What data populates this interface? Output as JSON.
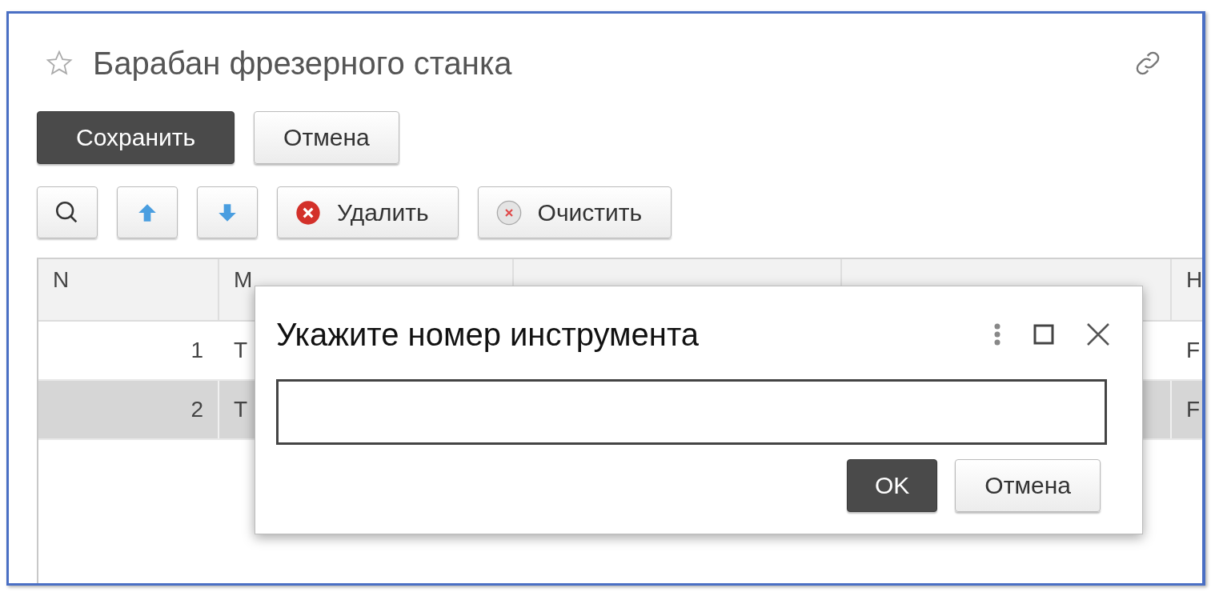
{
  "form": {
    "title": "Барабан фрезерного станка",
    "favorite": false
  },
  "commands": [
    {
      "label": "Сохранить",
      "kind": "primary"
    },
    {
      "label": "Отмена",
      "kind": "plain"
    }
  ],
  "toolbar": [
    {
      "kind": "search"
    },
    {
      "kind": "up"
    },
    {
      "kind": "down"
    },
    {
      "kind": "delete",
      "label": "Удалить"
    },
    {
      "kind": "clear",
      "label": "Очистить"
    }
  ],
  "table": {
    "header": {
      "n": "N",
      "column_2": "М",
      "column_5": "Н"
    },
    "rows": [
      {
        "n": "1",
        "column_2": "Т",
        "column_5": "F",
        "selected": false
      },
      {
        "n": "2",
        "column_2": "Т",
        "column_5": "F",
        "selected": true
      }
    ]
  },
  "dialog": {
    "title": "Укажите номер инструмента",
    "buttons": [
      {
        "label": "OK",
        "kind": "primary"
      },
      {
        "label": "Отмена",
        "kind": "plain"
      }
    ]
  }
}
